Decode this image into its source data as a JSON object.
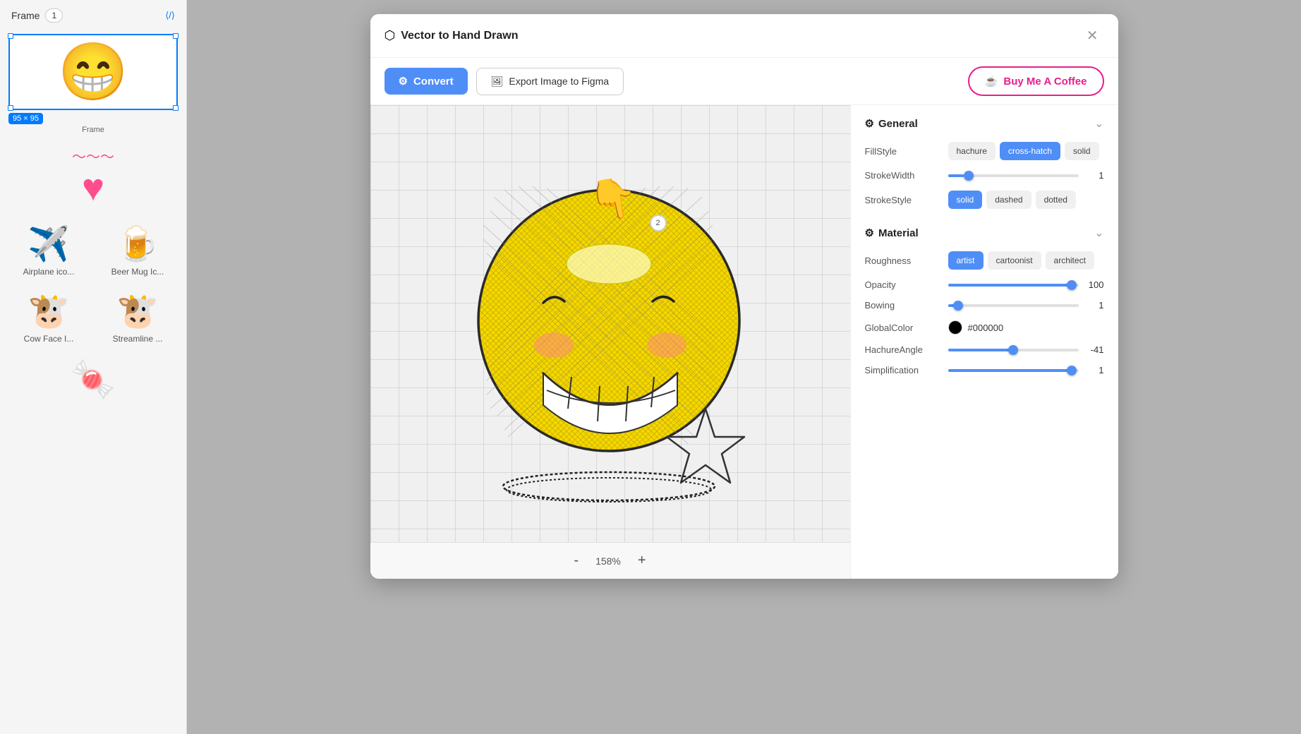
{
  "sidebar": {
    "header": {
      "frame_label": "Frame",
      "frame_number": "1",
      "frame_size": "95 × 95"
    },
    "items": [
      {
        "label": "Airplane ico...",
        "emoji": "✈️"
      },
      {
        "label": "Beer Mug Ic...",
        "emoji": "🍺"
      },
      {
        "label": "Cow Face I...",
        "emoji": "🐮"
      },
      {
        "label": "Streamline ...",
        "emoji": "🐮"
      },
      {
        "label": "🍬",
        "emoji": "🍬"
      }
    ]
  },
  "dialog": {
    "title": "Vector to Hand Drawn",
    "title_icon": "⬡",
    "close_label": "✕",
    "toolbar": {
      "convert_label": "Convert",
      "export_label": "Export Image to Figma",
      "coffee_label": "Buy Me A Coffee",
      "convert_icon": "⚙",
      "export_icon": "🖼"
    },
    "canvas": {
      "zoom_minus": "-",
      "zoom_level": "158%",
      "zoom_plus": "+"
    }
  },
  "panel": {
    "general": {
      "title": "General",
      "fill_style": {
        "label": "FillStyle",
        "options": [
          "hachure",
          "cross-hatch",
          "solid"
        ],
        "active": "cross-hatch"
      },
      "stroke_width": {
        "label": "StrokeWidth",
        "value": 1,
        "thumb_percent": 12
      },
      "stroke_style": {
        "label": "StrokeStyle",
        "options": [
          "solid",
          "dashed",
          "dotted"
        ],
        "active": "solid"
      }
    },
    "material": {
      "title": "Material",
      "roughness": {
        "label": "Roughness",
        "options": [
          "artist",
          "cartoonist",
          "architect"
        ],
        "active": "artist"
      },
      "opacity": {
        "label": "Opacity",
        "value": 100,
        "thumb_percent": 95
      },
      "bowing": {
        "label": "Bowing",
        "value": 1,
        "thumb_percent": 8
      },
      "global_color": {
        "label": "GlobalColor",
        "color": "#000000",
        "swatch": "#000000"
      },
      "hachure_angle": {
        "label": "HachureAngle",
        "value": -41,
        "thumb_percent": 50
      },
      "simplification": {
        "label": "Simplification",
        "value": 1,
        "thumb_percent": 95
      }
    }
  }
}
